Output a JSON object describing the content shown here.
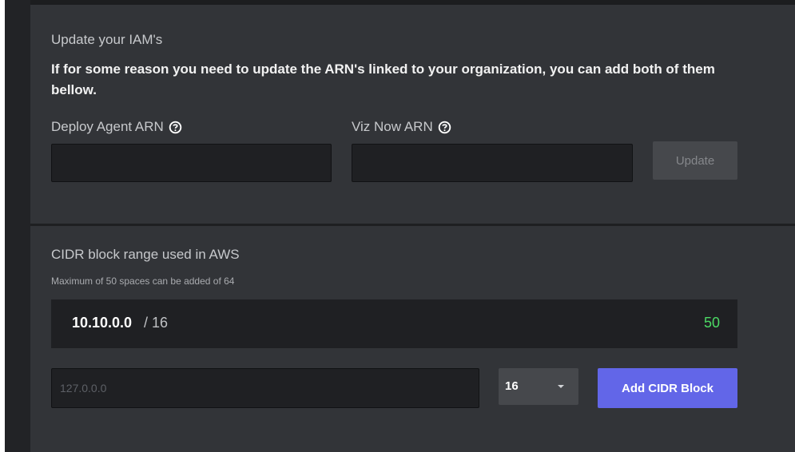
{
  "iam": {
    "title": "Update your IAM's",
    "description": "If for some reason you need to update the ARN's linked to your organization, you can add both of them bellow.",
    "deploy_agent_label": "Deploy Agent ARN",
    "deploy_agent_value": "",
    "viz_now_label": "Viz Now ARN",
    "viz_now_value": "",
    "update_label": "Update"
  },
  "cidr": {
    "title": "CIDR block range used in AWS",
    "note": "Maximum of 50 spaces can be added of 64",
    "block": {
      "ip": "10.10.0.0",
      "mask": "/ 16",
      "count": "50"
    },
    "input_placeholder": "127.0.0.0",
    "input_value": "",
    "mask_selected": "16",
    "add_label": "Add CIDR Block",
    "count_color": "#4cd964",
    "accent_color": "#6266e8"
  },
  "icons": {
    "help": "help-circle-icon",
    "dropdown": "chevron-down-icon"
  }
}
